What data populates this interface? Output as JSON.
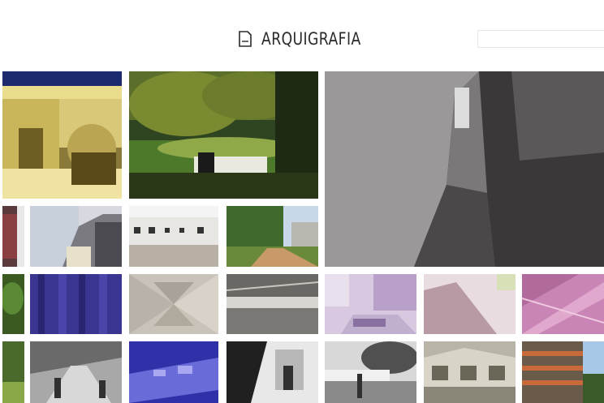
{
  "header": {
    "brand": "ARQUIGRAFIA",
    "logo_icon": "arquigrafia-logo-icon",
    "search_value": "",
    "search_placeholder": ""
  },
  "gallery": {
    "photo_count": 24,
    "colors": {
      "background": "#ffffff",
      "accent_purple": "#3a3590",
      "accent_pink": "#c985b5"
    }
  }
}
